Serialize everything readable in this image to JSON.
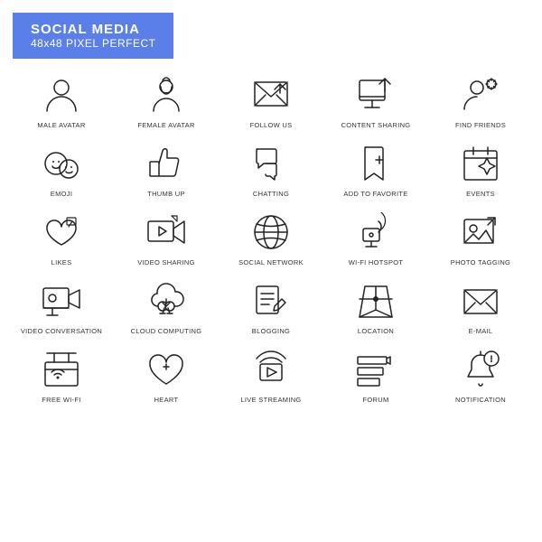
{
  "header": {
    "title": "SOCIAL MEDIA",
    "subtitle": "48x48 PIXEL PERFECT"
  },
  "icons": [
    {
      "id": "male-avatar",
      "label": "MALE AVATAR"
    },
    {
      "id": "female-avatar",
      "label": "FEMALE AVATAR"
    },
    {
      "id": "follow-us",
      "label": "FOLLOW US"
    },
    {
      "id": "content-sharing",
      "label": "CONTENT SHARING"
    },
    {
      "id": "find-friends",
      "label": "FIND FRIENDS"
    },
    {
      "id": "emoji",
      "label": "EMOJI"
    },
    {
      "id": "thumb-up",
      "label": "THUMB UP"
    },
    {
      "id": "chatting",
      "label": "CHATTING"
    },
    {
      "id": "add-to-favorite",
      "label": "ADD TO FAVORITE"
    },
    {
      "id": "events",
      "label": "EVENTS"
    },
    {
      "id": "likes",
      "label": "LIKES"
    },
    {
      "id": "video-sharing",
      "label": "VIDEO SHARING"
    },
    {
      "id": "social-network",
      "label": "SOCIAL NETWORK"
    },
    {
      "id": "wi-fi-hotspot",
      "label": "WI-FI HOTSPOT"
    },
    {
      "id": "photo-tagging",
      "label": "PHOTO TAGGING"
    },
    {
      "id": "video-conversation",
      "label": "VIDEO CONVERSATION"
    },
    {
      "id": "cloud-computing",
      "label": "CLOUD COMPUTING"
    },
    {
      "id": "blogging",
      "label": "BLOGGING"
    },
    {
      "id": "location",
      "label": "LOCATION"
    },
    {
      "id": "e-mail",
      "label": "E-MAIL"
    },
    {
      "id": "free-wi-fi",
      "label": "FREE WI-FI"
    },
    {
      "id": "heart",
      "label": "HEART"
    },
    {
      "id": "live-streaming",
      "label": "LIVE STREAMING"
    },
    {
      "id": "forum",
      "label": "FORUM"
    },
    {
      "id": "notification",
      "label": "NOTIFICATION"
    }
  ]
}
